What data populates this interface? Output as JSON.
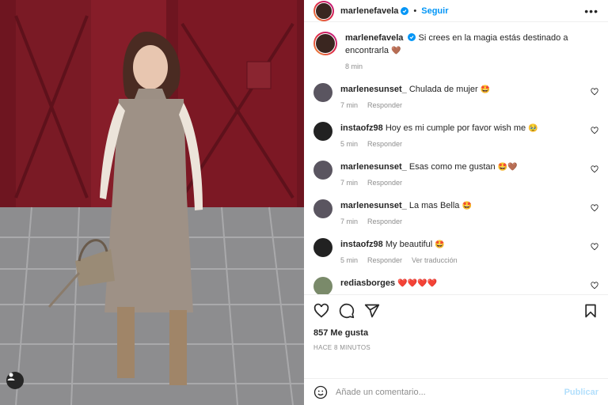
{
  "header": {
    "username": "marlenefavela",
    "separator": "•",
    "follow_label": "Seguir",
    "more_label": "•••"
  },
  "caption": {
    "username": "marlenefavela",
    "text": "Si crees en la magia estás destinado a encontrarla",
    "emoji": "🤎",
    "time": "8 min"
  },
  "comments": [
    {
      "username": "marlenesunset_",
      "text": "Chulada de mujer",
      "emoji": "🤩",
      "time": "7 min",
      "reply": "Responder",
      "translate": ""
    },
    {
      "username": "instaofz98",
      "text": "Hoy es mi cumple por favor wish me",
      "emoji": "🥹",
      "time": "5 min",
      "reply": "Responder",
      "translate": ""
    },
    {
      "username": "marlenesunset_",
      "text": "Esas como me gustan",
      "emoji": "🤩🤎",
      "time": "7 min",
      "reply": "Responder",
      "translate": ""
    },
    {
      "username": "marlenesunset_",
      "text": "La mas Bella",
      "emoji": "🤩",
      "time": "7 min",
      "reply": "Responder",
      "translate": ""
    },
    {
      "username": "instaofz98",
      "text": "My beautiful",
      "emoji": "🤩",
      "time": "5 min",
      "reply": "Responder",
      "translate": "Ver traducción"
    },
    {
      "username": "rediasborges",
      "text": "",
      "emoji": "❤️❤️❤️❤️",
      "time": "",
      "reply": "",
      "translate": ""
    }
  ],
  "likes": "857 Me gusta",
  "posted_ago": "HACE 8 MINUTOS",
  "composer": {
    "placeholder": "Añade un comentario...",
    "publish_label": "Publicar"
  },
  "icons": {
    "like": "heart-icon",
    "comment": "comment-icon",
    "share": "share-icon",
    "save": "bookmark-icon",
    "emoji": "emoji-icon",
    "tag": "user-tag-icon"
  },
  "colors": {
    "accent": "#0095f6",
    "publish_disabled": "#b2dffc",
    "muted": "#8e8e8e",
    "hearts": "#ed4956"
  }
}
